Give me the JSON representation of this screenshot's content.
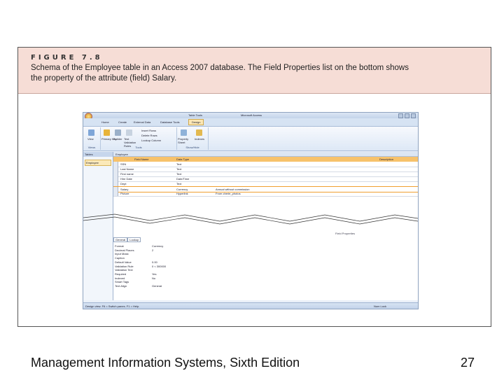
{
  "figure": {
    "label": "FIGURE 7.8",
    "caption_lines": [
      "Schema of the Employee table in an Access 2007 database. The Field Properties list on the bottom shows",
      "the property of the attribute (field) Salary."
    ]
  },
  "window": {
    "contextual_tab": "Table Tools",
    "app_title": "Microsoft Access",
    "tabs": [
      "Home",
      "Create",
      "External Data",
      "Database Tools",
      "Design"
    ],
    "ribbon": {
      "view": "View",
      "primary_key": "Primary Key",
      "builder": "Builder",
      "test_validation": "Test Validation Rules",
      "insert_rows": "Insert Rows",
      "delete_rows": "Delete Rows",
      "lookup_column": "Lookup Column",
      "property_sheet": "Property Sheet",
      "indexes": "Indexes",
      "groups": [
        "Views",
        "Tools",
        "Show/Hide"
      ]
    },
    "nav_pane": {
      "title": "Tables",
      "item": "Employee"
    },
    "document_tab": "Employee",
    "grid_headers": [
      "Field Name",
      "Data Type",
      "Description"
    ],
    "fields": [
      {
        "name": "SSN",
        "type": "Text",
        "desc": ""
      },
      {
        "name": "Last Name",
        "type": "Text",
        "desc": ""
      },
      {
        "name": "First name",
        "type": "Text",
        "desc": ""
      },
      {
        "name": "Hire Date",
        "type": "Date/Time",
        "desc": ""
      },
      {
        "name": "Dept",
        "type": "Text",
        "desc": ""
      },
      {
        "name": "Salary",
        "type": "Currency",
        "desc": "Annual without commission"
      },
      {
        "name": "Picture",
        "type": "Hyperlink",
        "desc": "From cherie_photos"
      }
    ],
    "field_properties_label": "Field Properties",
    "property_tabs": [
      "General",
      "Lookup"
    ],
    "properties": [
      {
        "name": "Format",
        "value": "Currency"
      },
      {
        "name": "Decimal Places",
        "value": "2"
      },
      {
        "name": "Input Mask",
        "value": ""
      },
      {
        "name": "Caption",
        "value": ""
      },
      {
        "name": "Default Value",
        "value": "0.00"
      },
      {
        "name": "Validation Rule",
        "value": "0 < 300000"
      },
      {
        "name": "Validation Text",
        "value": ""
      },
      {
        "name": "Required",
        "value": "Yes"
      },
      {
        "name": "Indexed",
        "value": "No"
      },
      {
        "name": "Smart Tags",
        "value": ""
      },
      {
        "name": "Text Align",
        "value": "General"
      }
    ],
    "status_left": "Design view. F6 = Switch panes. F1 = Help.",
    "status_right": "Num Lock"
  },
  "footer": {
    "title": "Management Information Systems, Sixth Edition",
    "page": "27"
  }
}
